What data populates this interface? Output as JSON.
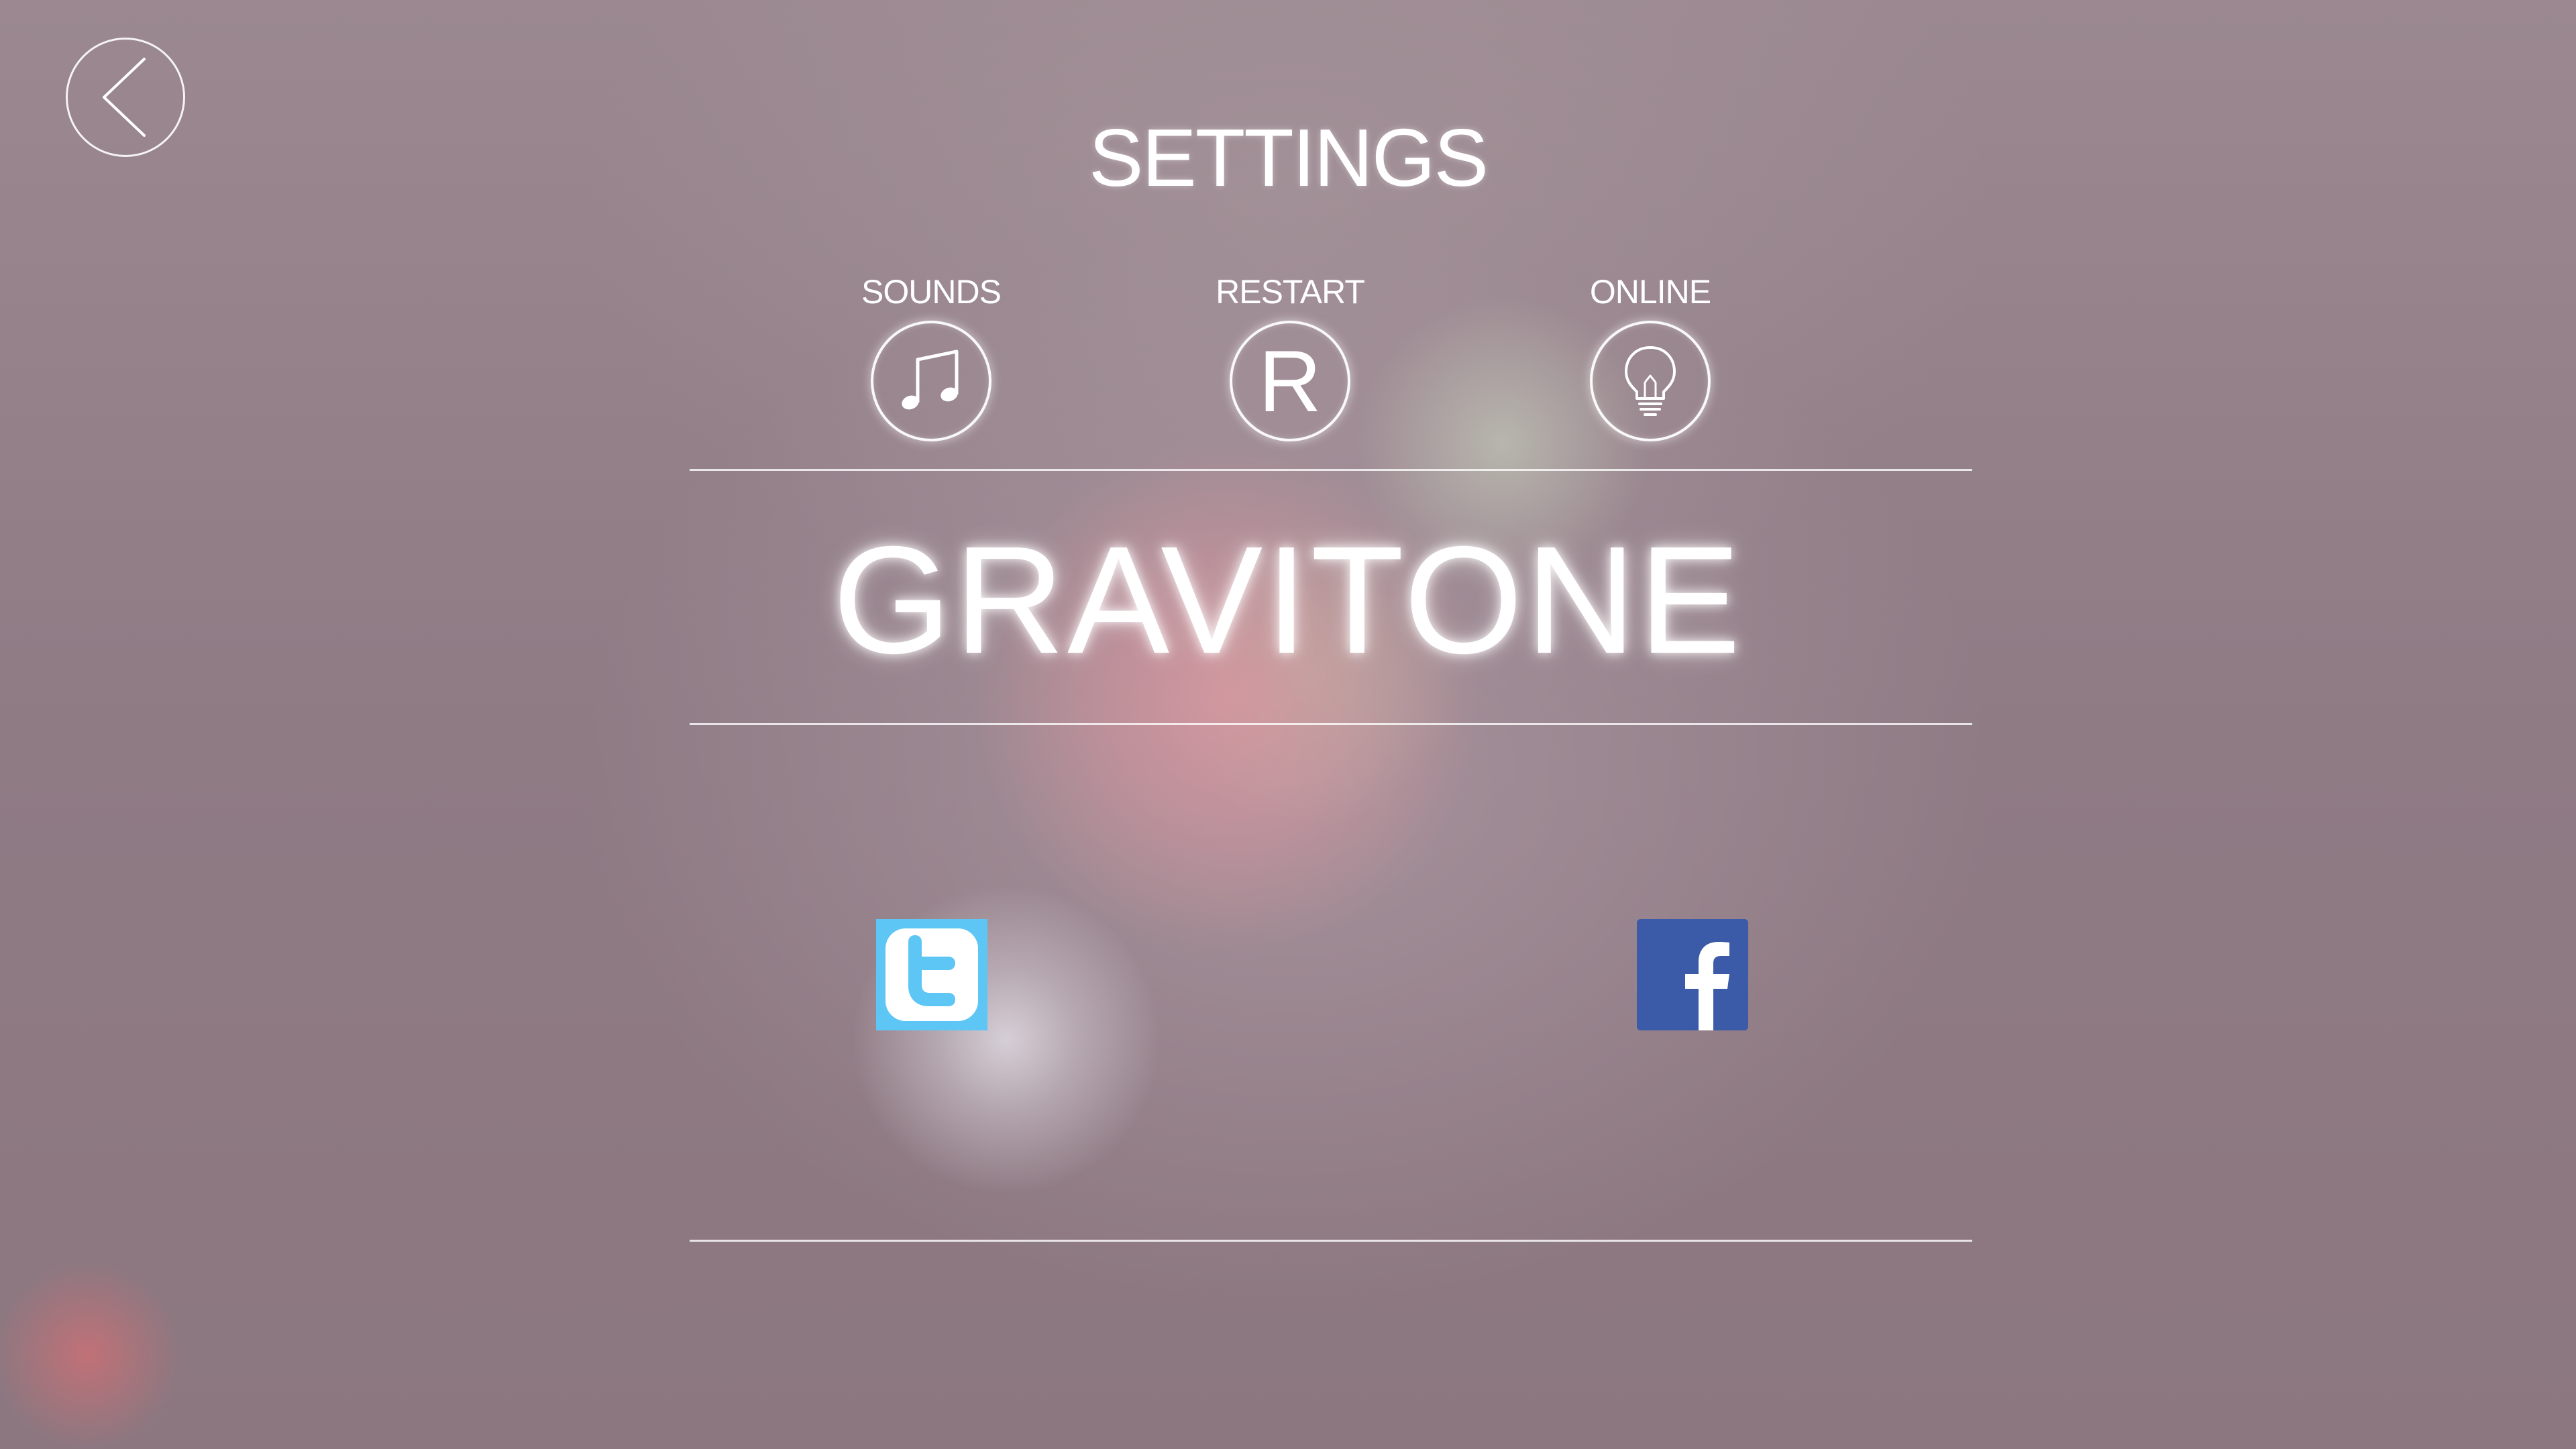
{
  "screen": {
    "title": "SETTINGS",
    "game_title": "GRAVITONE"
  },
  "navigation": {
    "back_icon": "chevron-left-icon"
  },
  "settings": [
    {
      "label": "SOUNDS",
      "icon": "music-note-icon"
    },
    {
      "label": "RESTART",
      "icon": "R"
    },
    {
      "label": "ONLINE",
      "icon": "lightbulb-icon"
    }
  ],
  "social": [
    {
      "name": "twitter",
      "icon": "twitter-icon",
      "color": "#5ec6f5"
    },
    {
      "name": "facebook",
      "icon": "facebook-icon",
      "color": "#3b5aa8"
    }
  ],
  "colors": {
    "background": "#8e7a82",
    "foreground": "#ffffff"
  }
}
